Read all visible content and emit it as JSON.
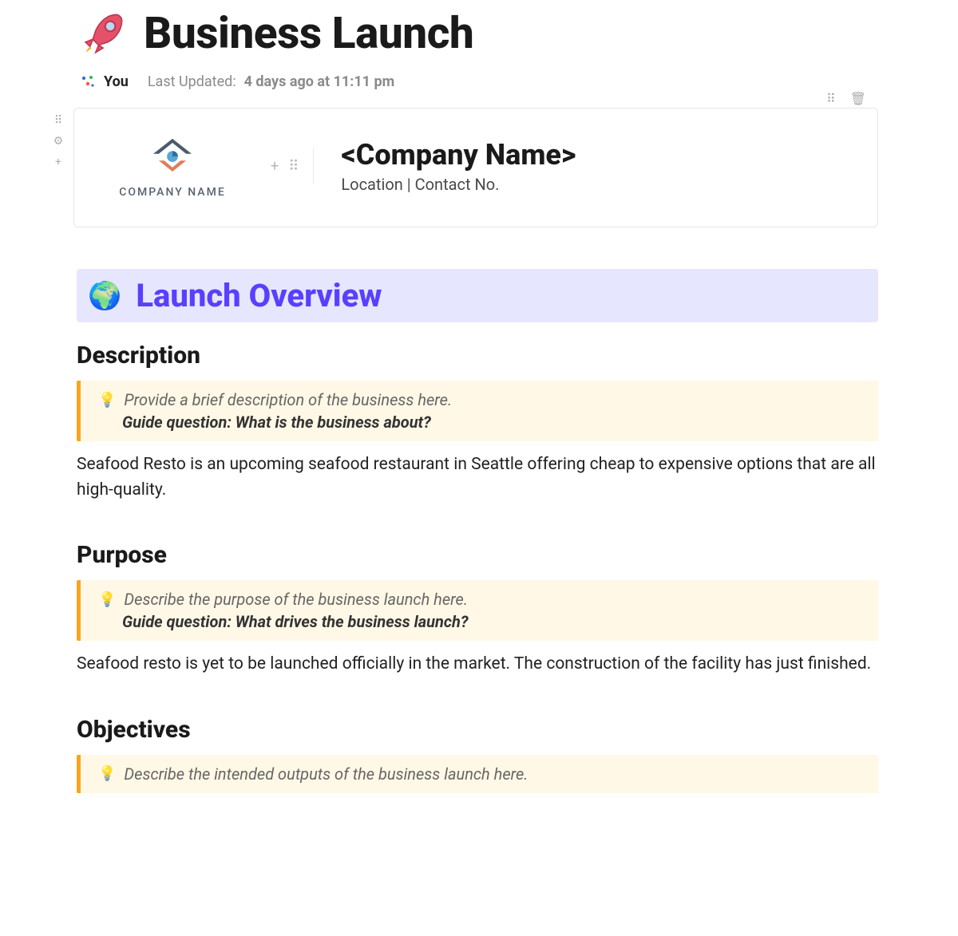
{
  "header": {
    "title": "Business Launch",
    "author": "You",
    "updated_label": "Last Updated: ",
    "updated_value": "4 days ago at 11:11 pm"
  },
  "company_card": {
    "logo_caption": "COMPANY NAME",
    "name_heading": "<Company Name>",
    "subline": "Location | Contact No."
  },
  "overview": {
    "banner_title": "Launch Overview"
  },
  "sections": {
    "description": {
      "heading": "Description",
      "hint": "Provide a brief description of the business here.",
      "guide": "Guide question: What is the business about?",
      "body": "Seafood Resto is an upcoming seafood restaurant in Seattle offering cheap to expensive options that are all high-quality."
    },
    "purpose": {
      "heading": "Purpose",
      "hint": "Describe the purpose of the business launch here.",
      "guide": "Guide question: What drives the business launch?",
      "body": "Seafood resto is yet to be launched officially in the market. The construction of the facility has just finished."
    },
    "objectives": {
      "heading": "Objectives",
      "hint": "Describe the intended outputs of the business launch here."
    }
  }
}
